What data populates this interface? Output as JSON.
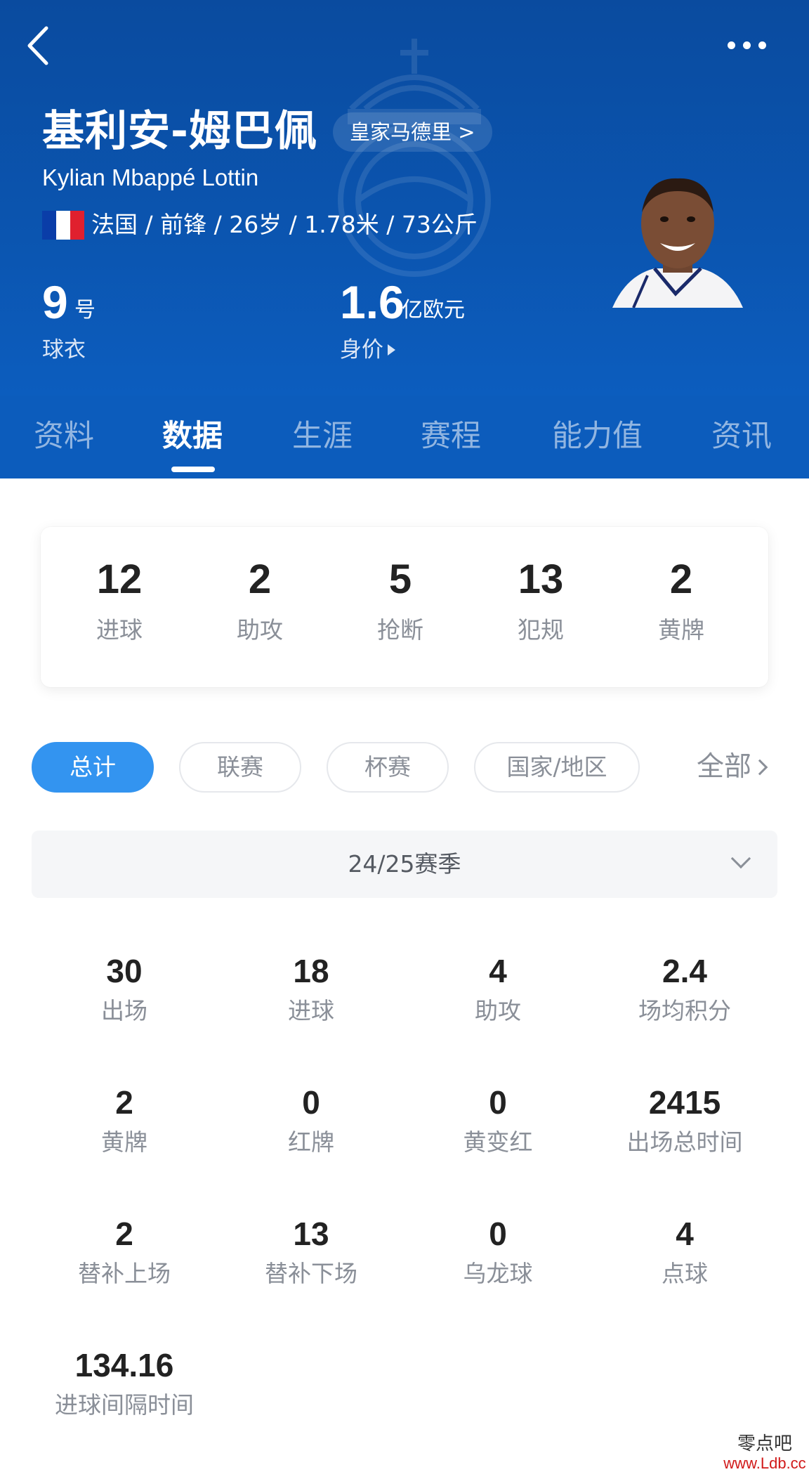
{
  "header": {
    "player_name_cn": "基利安-姆巴佩",
    "team_link": "皇家马德里 >",
    "player_name_en": "Kylian Mbappé Lottin",
    "bio_line": "法国 / 前锋 / 26岁 / 1.78米 / 73公斤",
    "flag_colors": [
      "#0a3da8",
      "#ffffff",
      "#e0202e"
    ],
    "jersey": {
      "number": "9",
      "unit": "号",
      "label": "球衣"
    },
    "market_value": {
      "amount": "1.6",
      "unit": "亿欧元",
      "label": "身价"
    }
  },
  "tabs": [
    {
      "label": "资料",
      "active": false
    },
    {
      "label": "数据",
      "active": true
    },
    {
      "label": "生涯",
      "active": false
    },
    {
      "label": "赛程",
      "active": false
    },
    {
      "label": "能力值",
      "active": false
    },
    {
      "label": "资讯",
      "active": false
    }
  ],
  "summary": [
    {
      "value": "12",
      "label": "进球"
    },
    {
      "value": "2",
      "label": "助攻"
    },
    {
      "value": "5",
      "label": "抢断"
    },
    {
      "value": "13",
      "label": "犯规"
    },
    {
      "value": "2",
      "label": "黄牌"
    }
  ],
  "filters": {
    "chips": [
      {
        "label": "总计",
        "active": true
      },
      {
        "label": "联赛",
        "active": false
      },
      {
        "label": "杯赛",
        "active": false
      },
      {
        "label": "国家/地区",
        "active": false
      }
    ],
    "all_label": "全部"
  },
  "season": {
    "selected": "24/25赛季"
  },
  "stats": [
    {
      "value": "30",
      "label": "出场"
    },
    {
      "value": "18",
      "label": "进球"
    },
    {
      "value": "4",
      "label": "助攻"
    },
    {
      "value": "2.4",
      "label": "场均积分"
    },
    {
      "value": "2",
      "label": "黄牌"
    },
    {
      "value": "0",
      "label": "红牌"
    },
    {
      "value": "0",
      "label": "黄变红"
    },
    {
      "value": "2415",
      "label": "出场总时间"
    },
    {
      "value": "2",
      "label": "替补上场"
    },
    {
      "value": "13",
      "label": "替补下场"
    },
    {
      "value": "0",
      "label": "乌龙球"
    },
    {
      "value": "4",
      "label": "点球"
    },
    {
      "value": "134.16",
      "label": "进球间隔时间"
    }
  ],
  "watermark": {
    "site_name": "零点吧",
    "url": "www.Ldb.cc"
  },
  "colors": {
    "header_bg": "#0b55b0",
    "accent": "#3394f0",
    "muted_text": "#8a8f98"
  }
}
